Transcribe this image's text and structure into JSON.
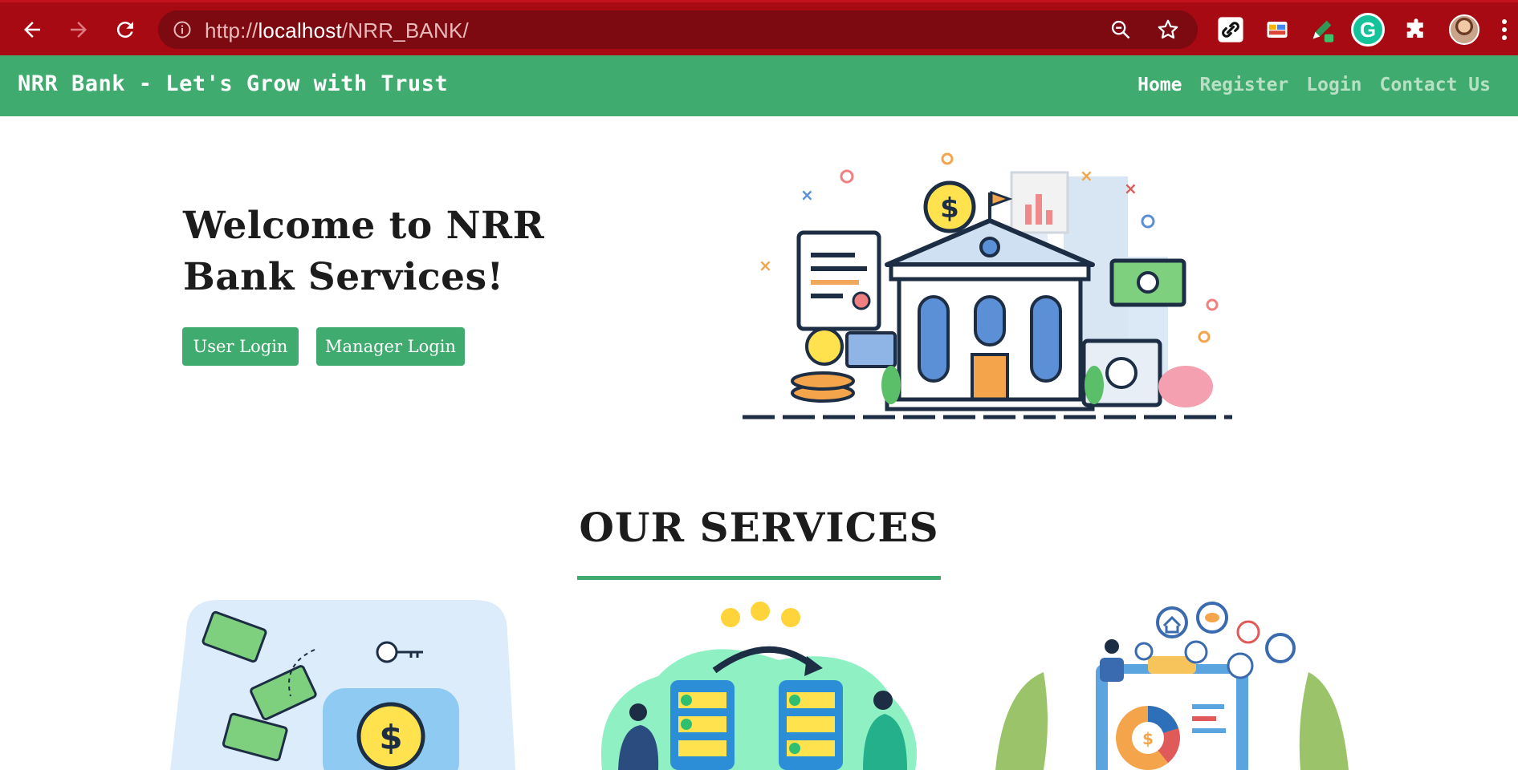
{
  "browser": {
    "url_scheme": "http://",
    "url_host": "localhost",
    "url_path": "/NRR_BANK/",
    "extension_letter": "G",
    "icons": [
      "back-icon",
      "forward-icon",
      "reload-icon",
      "info-icon",
      "zoom-icon",
      "star-icon",
      "link-extension-icon",
      "color-extension-icon",
      "pen-extension-icon",
      "grammarly-icon",
      "puzzle-icon",
      "profile-avatar",
      "menu-icon"
    ]
  },
  "navbar": {
    "brand": "NRR Bank - Let's Grow with Trust",
    "links": [
      {
        "label": "Home",
        "active": true
      },
      {
        "label": "Register",
        "active": false
      },
      {
        "label": "Login",
        "active": false
      },
      {
        "label": "Contact Us",
        "active": false
      }
    ]
  },
  "hero": {
    "title": "Welcome to NRR Bank Services!",
    "user_login_label": "User Login",
    "manager_login_label": "Manager Login"
  },
  "services": {
    "title": "OUR SERVICES"
  },
  "colors": {
    "chrome": "#a80a13",
    "omnibox": "#7c0a10",
    "accent": "#40ab6e",
    "nav_inactive": "#b7e0c4",
    "text": "#1c1c1c"
  }
}
